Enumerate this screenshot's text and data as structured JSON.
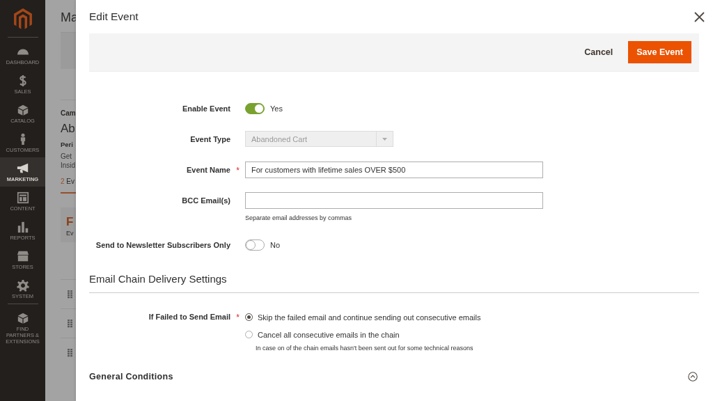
{
  "sidebar": {
    "items": [
      {
        "label": "DASHBOARD",
        "selected": false
      },
      {
        "label": "SALES",
        "selected": false
      },
      {
        "label": "CATALOG",
        "selected": false
      },
      {
        "label": "CUSTOMERS",
        "selected": false
      },
      {
        "label": "MARKETING",
        "selected": true
      },
      {
        "label": "CONTENT",
        "selected": false
      },
      {
        "label": "REPORTS",
        "selected": false
      },
      {
        "label": "STORES",
        "selected": false
      },
      {
        "label": "SYSTEM",
        "selected": false
      },
      {
        "label": "FIND PARTNERS & EXTENSIONS",
        "selected": false
      }
    ]
  },
  "background_page": {
    "title": "Ma",
    "section_label": "Cam",
    "heading": "Ab",
    "subheading": "Peri",
    "description": [
      "Get",
      "Insid"
    ],
    "events_count": "2",
    "events_label": "Ev",
    "card_title": "F",
    "card_text": "Ev"
  },
  "modal": {
    "title": "Edit Event",
    "toolbar": {
      "cancel": "Cancel",
      "save": "Save Event"
    },
    "fields": [
      {
        "kind": "toggle",
        "label": "Enable Event",
        "on": true,
        "value": "Yes"
      },
      {
        "kind": "select",
        "label": "Event Type",
        "disabled": true,
        "value": "Abandoned Cart"
      },
      {
        "kind": "text",
        "label": "Event Name",
        "required_mark": "*",
        "value": "For customers with lifetime sales OVER $500"
      },
      {
        "kind": "text",
        "label": "BCC Email(s)",
        "note": "Separate email addresses by commas"
      },
      {
        "kind": "toggle",
        "label": "Send to Newsletter Subscribers Only",
        "on": false,
        "value": "No"
      }
    ],
    "section": {
      "title": "Email Chain Delivery Settings",
      "fields": [
        {
          "kind": "radio",
          "label": "If Failed to Send Email",
          "required_mark": "*",
          "options": [
            {
              "label": "Skip the failed email and continue sending out consecutive emails",
              "selected": true
            },
            {
              "label": "Cancel all consecutive emails in the chain",
              "selected": false
            }
          ],
          "note": "In case on of the chain emails hasn't been sent out for some technical reasons"
        }
      ]
    },
    "collapsible": {
      "title": "General Conditions",
      "expanded": true
    }
  }
}
